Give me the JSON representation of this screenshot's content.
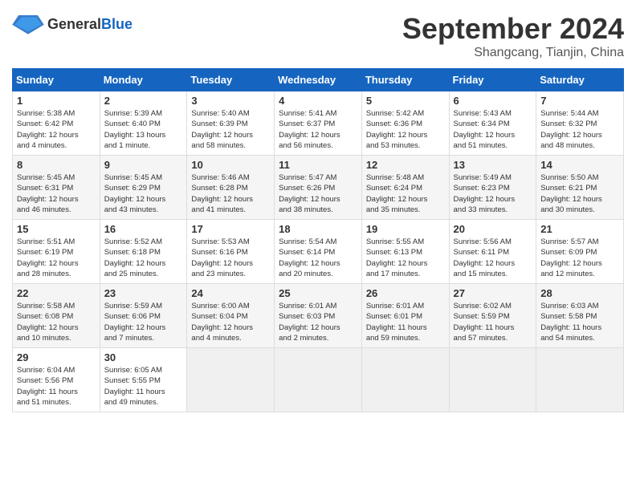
{
  "header": {
    "logo_general": "General",
    "logo_blue": "Blue",
    "month": "September 2024",
    "location": "Shangcang, Tianjin, China"
  },
  "days_of_week": [
    "Sunday",
    "Monday",
    "Tuesday",
    "Wednesday",
    "Thursday",
    "Friday",
    "Saturday"
  ],
  "weeks": [
    {
      "shaded": false,
      "days": [
        {
          "num": "1",
          "info": "Sunrise: 5:38 AM\nSunset: 6:42 PM\nDaylight: 12 hours\nand 4 minutes."
        },
        {
          "num": "2",
          "info": "Sunrise: 5:39 AM\nSunset: 6:40 PM\nDaylight: 13 hours\nand 1 minute."
        },
        {
          "num": "3",
          "info": "Sunrise: 5:40 AM\nSunset: 6:39 PM\nDaylight: 12 hours\nand 58 minutes."
        },
        {
          "num": "4",
          "info": "Sunrise: 5:41 AM\nSunset: 6:37 PM\nDaylight: 12 hours\nand 56 minutes."
        },
        {
          "num": "5",
          "info": "Sunrise: 5:42 AM\nSunset: 6:36 PM\nDaylight: 12 hours\nand 53 minutes."
        },
        {
          "num": "6",
          "info": "Sunrise: 5:43 AM\nSunset: 6:34 PM\nDaylight: 12 hours\nand 51 minutes."
        },
        {
          "num": "7",
          "info": "Sunrise: 5:44 AM\nSunset: 6:32 PM\nDaylight: 12 hours\nand 48 minutes."
        }
      ]
    },
    {
      "shaded": true,
      "days": [
        {
          "num": "8",
          "info": "Sunrise: 5:45 AM\nSunset: 6:31 PM\nDaylight: 12 hours\nand 46 minutes."
        },
        {
          "num": "9",
          "info": "Sunrise: 5:45 AM\nSunset: 6:29 PM\nDaylight: 12 hours\nand 43 minutes."
        },
        {
          "num": "10",
          "info": "Sunrise: 5:46 AM\nSunset: 6:28 PM\nDaylight: 12 hours\nand 41 minutes."
        },
        {
          "num": "11",
          "info": "Sunrise: 5:47 AM\nSunset: 6:26 PM\nDaylight: 12 hours\nand 38 minutes."
        },
        {
          "num": "12",
          "info": "Sunrise: 5:48 AM\nSunset: 6:24 PM\nDaylight: 12 hours\nand 35 minutes."
        },
        {
          "num": "13",
          "info": "Sunrise: 5:49 AM\nSunset: 6:23 PM\nDaylight: 12 hours\nand 33 minutes."
        },
        {
          "num": "14",
          "info": "Sunrise: 5:50 AM\nSunset: 6:21 PM\nDaylight: 12 hours\nand 30 minutes."
        }
      ]
    },
    {
      "shaded": false,
      "days": [
        {
          "num": "15",
          "info": "Sunrise: 5:51 AM\nSunset: 6:19 PM\nDaylight: 12 hours\nand 28 minutes."
        },
        {
          "num": "16",
          "info": "Sunrise: 5:52 AM\nSunset: 6:18 PM\nDaylight: 12 hours\nand 25 minutes."
        },
        {
          "num": "17",
          "info": "Sunrise: 5:53 AM\nSunset: 6:16 PM\nDaylight: 12 hours\nand 23 minutes."
        },
        {
          "num": "18",
          "info": "Sunrise: 5:54 AM\nSunset: 6:14 PM\nDaylight: 12 hours\nand 20 minutes."
        },
        {
          "num": "19",
          "info": "Sunrise: 5:55 AM\nSunset: 6:13 PM\nDaylight: 12 hours\nand 17 minutes."
        },
        {
          "num": "20",
          "info": "Sunrise: 5:56 AM\nSunset: 6:11 PM\nDaylight: 12 hours\nand 15 minutes."
        },
        {
          "num": "21",
          "info": "Sunrise: 5:57 AM\nSunset: 6:09 PM\nDaylight: 12 hours\nand 12 minutes."
        }
      ]
    },
    {
      "shaded": true,
      "days": [
        {
          "num": "22",
          "info": "Sunrise: 5:58 AM\nSunset: 6:08 PM\nDaylight: 12 hours\nand 10 minutes."
        },
        {
          "num": "23",
          "info": "Sunrise: 5:59 AM\nSunset: 6:06 PM\nDaylight: 12 hours\nand 7 minutes."
        },
        {
          "num": "24",
          "info": "Sunrise: 6:00 AM\nSunset: 6:04 PM\nDaylight: 12 hours\nand 4 minutes."
        },
        {
          "num": "25",
          "info": "Sunrise: 6:01 AM\nSunset: 6:03 PM\nDaylight: 12 hours\nand 2 minutes."
        },
        {
          "num": "26",
          "info": "Sunrise: 6:01 AM\nSunset: 6:01 PM\nDaylight: 11 hours\nand 59 minutes."
        },
        {
          "num": "27",
          "info": "Sunrise: 6:02 AM\nSunset: 5:59 PM\nDaylight: 11 hours\nand 57 minutes."
        },
        {
          "num": "28",
          "info": "Sunrise: 6:03 AM\nSunset: 5:58 PM\nDaylight: 11 hours\nand 54 minutes."
        }
      ]
    },
    {
      "shaded": false,
      "days": [
        {
          "num": "29",
          "info": "Sunrise: 6:04 AM\nSunset: 5:56 PM\nDaylight: 11 hours\nand 51 minutes."
        },
        {
          "num": "30",
          "info": "Sunrise: 6:05 AM\nSunset: 5:55 PM\nDaylight: 11 hours\nand 49 minutes."
        },
        {
          "num": "",
          "info": ""
        },
        {
          "num": "",
          "info": ""
        },
        {
          "num": "",
          "info": ""
        },
        {
          "num": "",
          "info": ""
        },
        {
          "num": "",
          "info": ""
        }
      ]
    }
  ]
}
